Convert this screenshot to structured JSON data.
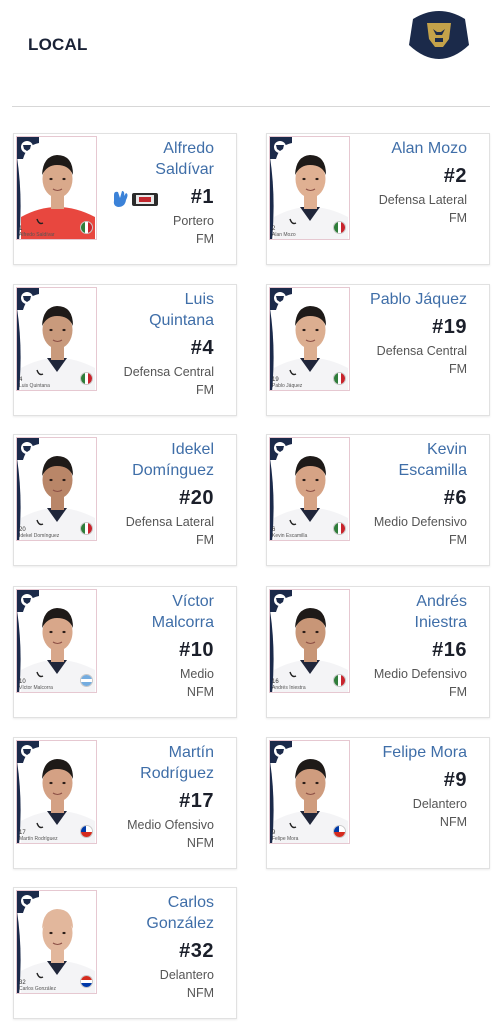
{
  "header": {
    "title": "LOCAL"
  },
  "players": [
    {
      "name_lines": [
        "Alfredo",
        "Saldívar"
      ],
      "number": "#1",
      "position": "Portero",
      "status": "FM",
      "photo_num": "1",
      "photo_name": "Alfredo Saldívar",
      "flag": "mexico",
      "kit": "gk",
      "has_gk_icons": true
    },
    {
      "name_lines": [
        "Alan Mozo"
      ],
      "number": "#2",
      "position": "Defensa Lateral",
      "status": "FM",
      "photo_num": "2",
      "photo_name": "Alan Mozo",
      "flag": "mexico",
      "kit": "white"
    },
    {
      "name_lines": [
        "Luis",
        "Quintana"
      ],
      "number": "#4",
      "position": "Defensa Central",
      "status": "FM",
      "photo_num": "4",
      "photo_name": "Luis Quintana",
      "flag": "mexico",
      "kit": "white"
    },
    {
      "name_lines": [
        "Pablo Jáquez"
      ],
      "number": "#19",
      "position": "Defensa Central",
      "status": "FM",
      "photo_num": "19",
      "photo_name": "Pablo Jáquez",
      "flag": "mexico",
      "kit": "white"
    },
    {
      "name_lines": [
        "Idekel",
        "Domínguez"
      ],
      "number": "#20",
      "position": "Defensa Lateral",
      "status": "FM",
      "photo_num": "20",
      "photo_name": "Idekel Domínguez",
      "flag": "mexico",
      "kit": "white"
    },
    {
      "name_lines": [
        "Kevin",
        "Escamilla"
      ],
      "number": "#6",
      "position": "Medio Defensivo",
      "status": "FM",
      "photo_num": "6",
      "photo_name": "Kevin Escamilla",
      "flag": "mexico",
      "kit": "white"
    },
    {
      "name_lines": [
        "Víctor",
        "Malcorra"
      ],
      "number": "#10",
      "position": "Medio",
      "status": "NFM",
      "photo_num": "10",
      "photo_name": "Víctor Malcorra",
      "flag": "argentina",
      "kit": "white"
    },
    {
      "name_lines": [
        "Andrés",
        "Iniestra"
      ],
      "number": "#16",
      "position": "Medio Defensivo",
      "status": "FM",
      "photo_num": "16",
      "photo_name": "Andrés Iniestra",
      "flag": "mexico",
      "kit": "white"
    },
    {
      "name_lines": [
        "Martín",
        "Rodríguez"
      ],
      "number": "#17",
      "position": "Medio Ofensivo",
      "status": "NFM",
      "photo_num": "17",
      "photo_name": "Martín Rodríguez",
      "flag": "chile",
      "kit": "white"
    },
    {
      "name_lines": [
        "Felipe Mora"
      ],
      "number": "#9",
      "position": "Delantero",
      "status": "NFM",
      "photo_num": "9",
      "photo_name": "Felipe Mora",
      "flag": "chile",
      "kit": "white"
    },
    {
      "name_lines": [
        "Carlos",
        "González"
      ],
      "number": "#32",
      "position": "Delantero",
      "status": "NFM",
      "photo_num": "32",
      "photo_name": "Carlos González",
      "flag": "paraguay",
      "kit": "white"
    }
  ],
  "colors": {
    "name": "#3f6ea8",
    "navy": "#1b2a4a",
    "gold": "#c4a24a"
  }
}
